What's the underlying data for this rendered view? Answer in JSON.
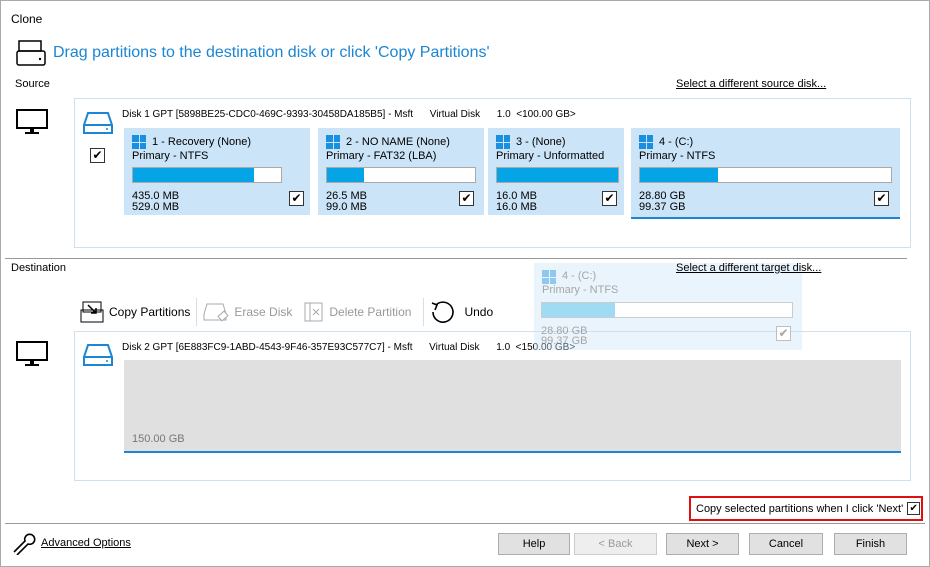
{
  "window": {
    "title": "Clone"
  },
  "header": {
    "text": "Drag partitions to the destination disk or click 'Copy Partitions'"
  },
  "source": {
    "label": "Source",
    "link": "Select a different source disk...",
    "disk": "Disk 1 GPT [5898BE25-CDC0-469C-9393-30458DA185B5] - Msft      Virtual Disk      1.0  <100.00 GB>",
    "partitions": [
      {
        "name": "1 - Recovery (None)",
        "type": "Primary - NTFS",
        "used": "435.0 MB",
        "total": "529.0 MB",
        "fill": 82,
        "checked": true
      },
      {
        "name": "2 - NO NAME (None)",
        "type": "Primary - FAT32 (LBA)",
        "used": "26.5 MB",
        "total": "99.0 MB",
        "fill": 27,
        "checked": true
      },
      {
        "name": "3 -  (None)",
        "type": "Primary - Unformatted",
        "used": "16.0 MB",
        "total": "16.0 MB",
        "fill": 100,
        "checked": true
      },
      {
        "name": "4 -  (C:)",
        "type": "Primary - NTFS",
        "used": "28.80 GB",
        "total": "99.37 GB",
        "fill": 29,
        "checked": true
      }
    ]
  },
  "destination": {
    "label": "Destination",
    "link": "Select a different target disk...",
    "toolbar": {
      "copy": "Copy Partitions",
      "erase": "Erase Disk",
      "delete": "Delete Partition",
      "undo": "Undo"
    },
    "disk": "Disk 2 GPT [6E883FC9-1ABD-4543-9F46-357E93C577C7] - Msft      Virtual Disk      1.0  <150.00 GB>",
    "unallocated": "150.00 GB"
  },
  "drag_ghost": {
    "name": "4 -  (C:)",
    "type": "Primary - NTFS",
    "used": "28.80 GB",
    "total": "99.37 GB",
    "fill": 29
  },
  "copy_option": {
    "label": "Copy selected partitions when I click 'Next'",
    "checked": true
  },
  "footer": {
    "advanced": "Advanced Options",
    "help": "Help",
    "back": "< Back",
    "next": "Next >",
    "cancel": "Cancel",
    "finish": "Finish"
  }
}
